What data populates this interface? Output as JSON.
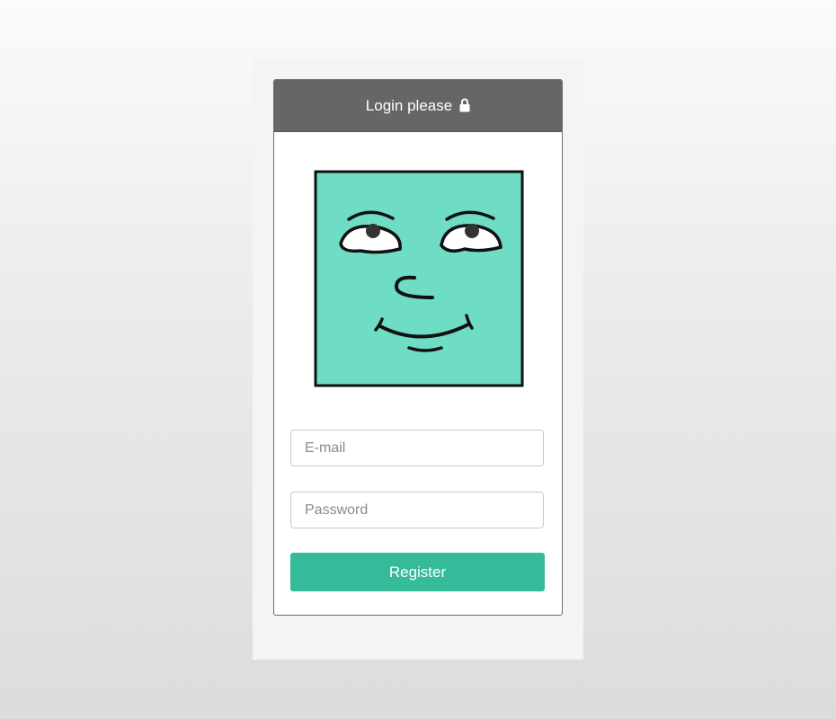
{
  "login": {
    "header_title": "Login please",
    "lock_icon": "lock-icon",
    "avatar_icon": "smiling-face-avatar",
    "email_placeholder": "E-mail",
    "email_value": "",
    "password_placeholder": "Password",
    "password_value": "",
    "register_label": "Register"
  },
  "colors": {
    "header_bg": "#666666",
    "accent": "#35bb99",
    "avatar_fill": "#6fdcc6"
  }
}
